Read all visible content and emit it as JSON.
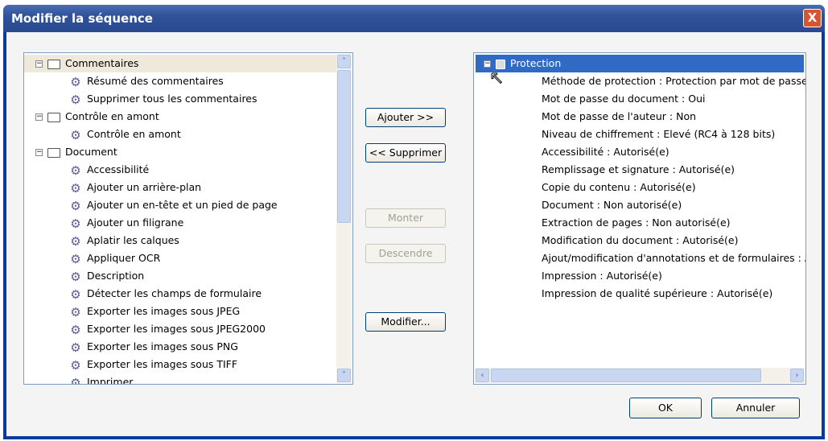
{
  "window": {
    "title": "Modifier la séquence",
    "close_label": "X"
  },
  "left_tree": [
    {
      "type": "folder",
      "label": "Commentaires",
      "expanded": true,
      "selected": true
    },
    {
      "type": "cmd",
      "label": "Résumé des commentaires"
    },
    {
      "type": "cmd",
      "label": "Supprimer tous les commentaires"
    },
    {
      "type": "folder",
      "label": "Contrôle en amont",
      "expanded": true
    },
    {
      "type": "cmd",
      "label": "Contrôle en amont"
    },
    {
      "type": "folder",
      "label": "Document",
      "expanded": true
    },
    {
      "type": "cmd",
      "label": "Accessibilité"
    },
    {
      "type": "cmd",
      "label": "Ajouter un arrière-plan"
    },
    {
      "type": "cmd",
      "label": "Ajouter un en-tête et un pied de page"
    },
    {
      "type": "cmd",
      "label": "Ajouter un filigrane"
    },
    {
      "type": "cmd",
      "label": "Aplatir les calques"
    },
    {
      "type": "cmd",
      "label": "Appliquer OCR"
    },
    {
      "type": "cmd",
      "label": "Description"
    },
    {
      "type": "cmd",
      "label": "Détecter les champs de formulaire"
    },
    {
      "type": "cmd",
      "label": "Exporter les images sous JPEG"
    },
    {
      "type": "cmd",
      "label": "Exporter les images sous JPEG2000"
    },
    {
      "type": "cmd",
      "label": "Exporter les images sous PNG"
    },
    {
      "type": "cmd",
      "label": "Exporter les images sous TIFF"
    },
    {
      "type": "cmd",
      "label": "Imprimer"
    }
  ],
  "buttons": {
    "add": "Ajouter >>",
    "remove": "<< Supprimer",
    "up": "Monter",
    "down": "Descendre",
    "edit": "Modifier...",
    "ok": "OK",
    "cancel": "Annuler"
  },
  "right_tree": {
    "root": "Protection",
    "items": [
      "Méthode de protection : Protection par mot de passe",
      "Mot de passe du document : Oui",
      "Mot de passe de l'auteur : Non",
      "Niveau de chiffrement : Elevé (RC4 à 128 bits)",
      "Accessibilité : Autorisé(e)",
      "Remplissage et signature : Autorisé(e)",
      "Copie du contenu : Autorisé(e)",
      "Document : Non autorisé(e)",
      "Extraction de pages : Non autorisé(e)",
      "Modification du document : Autorisé(e)",
      "Ajout/modification d'annotations et de formulaires : Autorisé(e)",
      "Impression : Autorisé(e)",
      "Impression de qualité supérieure : Autorisé(e)"
    ]
  },
  "colors": {
    "selection": "#316ac5",
    "title_bar": "#2f5298"
  }
}
